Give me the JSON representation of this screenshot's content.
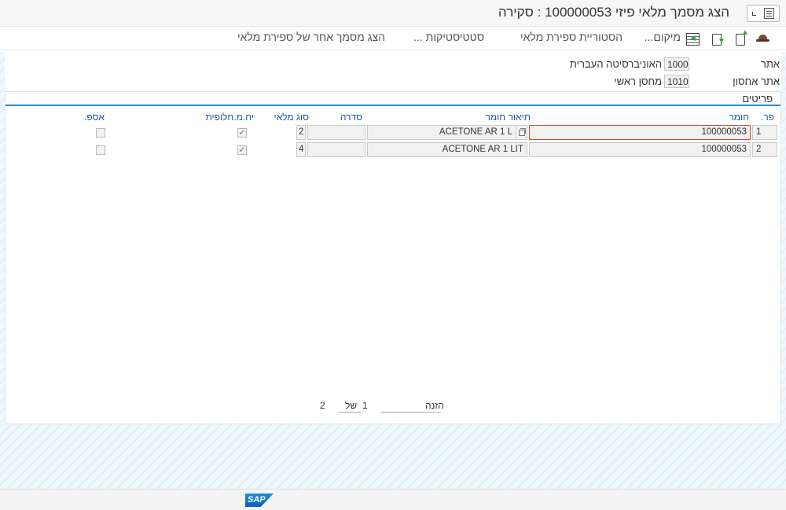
{
  "title": "הצג מסמך מלאי פיזי 100000053 : סקירה",
  "toolbar": {
    "actions": [
      {
        "label": "הצג מסמך אחר של ספירת מלאי"
      },
      {
        "label": "סטטיסטיקות ..."
      },
      {
        "label": "הסטוריית ספירת מלאי"
      },
      {
        "label": "מיקום..."
      }
    ],
    "icons": [
      "hat-icon",
      "upload-icon",
      "download-icon",
      "position-icon"
    ]
  },
  "header": {
    "plant": {
      "label": "אתר",
      "code": "1000",
      "text": "האוניברסיטה העברית"
    },
    "storage": {
      "label": "אתר אחסון",
      "code": "1010",
      "text": "מחסן ראשי"
    }
  },
  "items_panel": {
    "title": "פריטים",
    "columns": {
      "item": "פר.",
      "material": "חומר",
      "description": "תיאור חומר",
      "batch": "סדרה",
      "stock_type": "סוג מלאי",
      "alt_unit": "יח.מ.חלופית",
      "asp": "אספ."
    },
    "rows": [
      {
        "item": "1",
        "material": "100000053",
        "description": "ACETONE AR 1 L",
        "batch": "",
        "stock_type": "2",
        "alt_unit": "✓",
        "asp": ""
      },
      {
        "item": "2",
        "material": "100000053",
        "description": "ACETONE AR 1 LIT",
        "batch": "",
        "stock_type": "4",
        "alt_unit": "✓",
        "asp": ""
      }
    ]
  },
  "pager": {
    "entry_label": "הזנה",
    "current": "1",
    "of_label": "של",
    "total": "2"
  },
  "footer": {
    "logo": "SAP"
  }
}
